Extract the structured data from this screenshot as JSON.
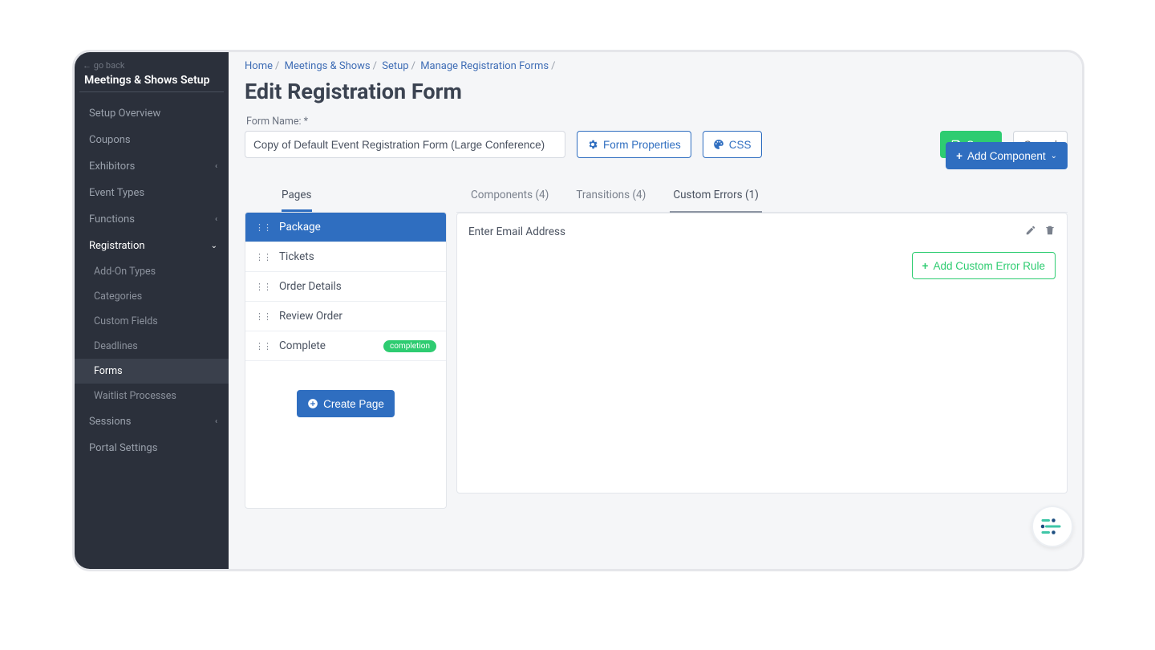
{
  "sidebar": {
    "go_back": "← go back",
    "title": "Meetings & Shows Setup",
    "items": [
      {
        "label": "Setup Overview",
        "kind": "item"
      },
      {
        "label": "Coupons",
        "kind": "item"
      },
      {
        "label": "Exhibitors",
        "kind": "expand",
        "open": false
      },
      {
        "label": "Event Types",
        "kind": "item"
      },
      {
        "label": "Functions",
        "kind": "expand",
        "open": false
      },
      {
        "label": "Registration",
        "kind": "expand",
        "open": true
      },
      {
        "label": "Sessions",
        "kind": "expand",
        "open": false
      },
      {
        "label": "Portal Settings",
        "kind": "item"
      }
    ],
    "registration_children": [
      {
        "label": "Add-On Types"
      },
      {
        "label": "Categories"
      },
      {
        "label": "Custom Fields"
      },
      {
        "label": "Deadlines"
      },
      {
        "label": "Forms",
        "active": true
      },
      {
        "label": "Waitlist Processes"
      }
    ]
  },
  "breadcrumb": [
    "Home",
    "Meetings & Shows",
    "Setup",
    "Manage Registration Forms"
  ],
  "page_title": "Edit Registration Form",
  "form": {
    "name_label": "Form Name: *",
    "name_value": "Copy of Default Event Registration Form (Large Conference)",
    "properties_btn": "Form Properties",
    "css_btn": "CSS",
    "save_btn": "Save",
    "cancel_btn": "Cancel"
  },
  "pages": {
    "tab_label": "Pages",
    "items": [
      {
        "label": "Package",
        "active": true
      },
      {
        "label": "Tickets"
      },
      {
        "label": "Order Details"
      },
      {
        "label": "Review Order"
      },
      {
        "label": "Complete",
        "badge": "completion"
      }
    ],
    "create_btn": "Create Page"
  },
  "detail": {
    "add_component_btn": "Add Component",
    "tabs": [
      {
        "label": "Components (4)"
      },
      {
        "label": "Transitions (4)"
      },
      {
        "label": "Custom Errors (1)",
        "active": true
      }
    ],
    "error_row": "Enter Email Address",
    "add_rule_btn": "Add Custom Error Rule"
  }
}
